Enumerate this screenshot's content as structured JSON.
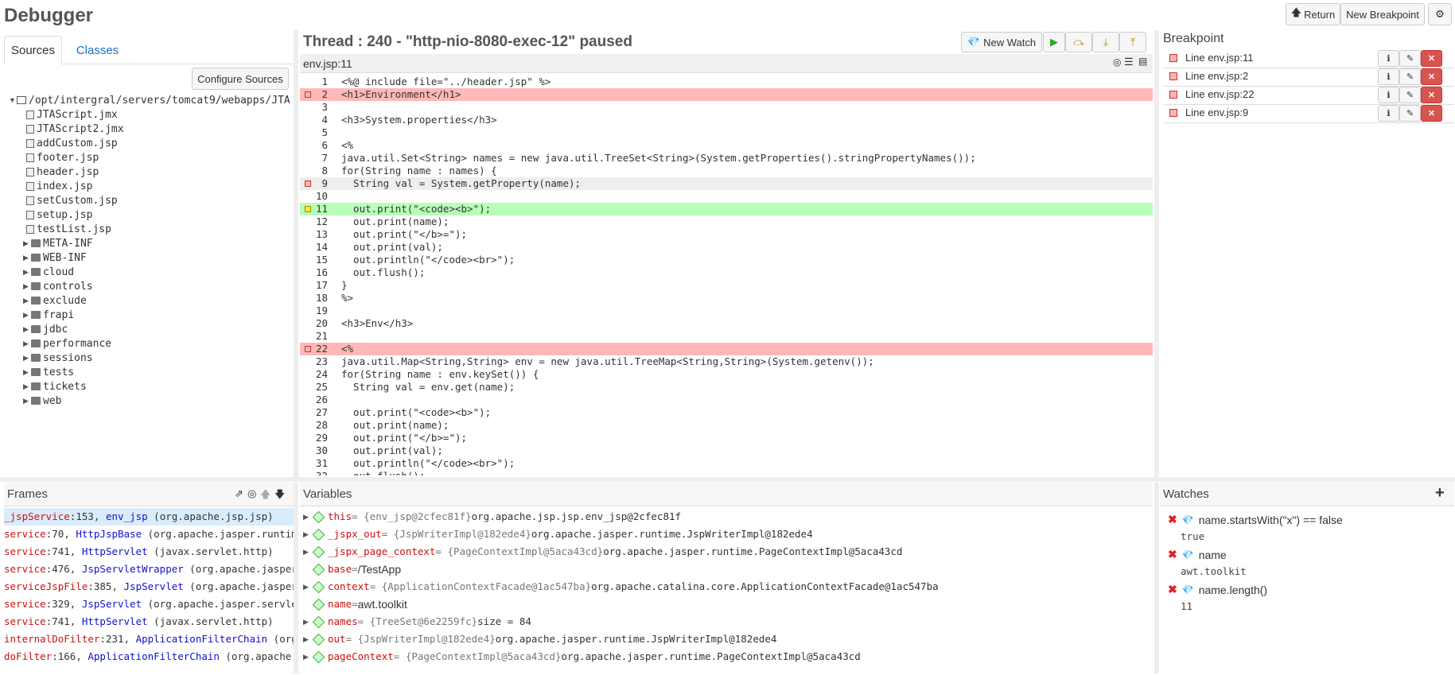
{
  "app": {
    "title": "Debugger",
    "return_label": "Return",
    "new_breakpoint_label": "New Breakpoint",
    "settings_icon": "gear-icon"
  },
  "sources": {
    "tabs": [
      "Sources",
      "Classes"
    ],
    "configure_label": "Configure Sources",
    "root": "/opt/intergral/servers/tomcat9/webapps/JTA",
    "files": [
      "JTAScript.jmx",
      "JTAScript2.jmx",
      "addCustom.jsp",
      "footer.jsp",
      "header.jsp",
      "index.jsp",
      "setCustom.jsp",
      "setup.jsp",
      "testList.jsp"
    ],
    "folders": [
      "META-INF",
      "WEB-INF",
      "cloud",
      "controls",
      "exclude",
      "frapi",
      "jdbc",
      "performance",
      "sessions",
      "tests",
      "tickets",
      "web"
    ]
  },
  "editor": {
    "thread_title": "Thread : 240 - \"http-nio-8080-exec-12\" paused",
    "new_watch_label": "New Watch",
    "filename": "env.jsp:11",
    "lines": [
      "<%@ include file=\"../header.jsp\" %>",
      "<h1>Environment</h1>",
      "",
      "<h3>System.properties</h3>",
      "",
      "<%",
      "java.util.Set<String> names = new java.util.TreeSet<String>(System.getProperties().stringPropertyNames());",
      "for(String name : names) {",
      "  String val = System.getProperty(name);",
      "",
      "  out.print(\"<code><b>\");",
      "  out.print(name);",
      "  out.print(\"</b>=\");",
      "  out.print(val);",
      "  out.println(\"</code><br>\");",
      "  out.flush();",
      "}",
      "%>",
      "",
      "<h3>Env</h3>",
      "",
      "<%",
      "java.util.Map<String,String> env = new java.util.TreeMap<String,String>(System.getenv());",
      "for(String name : env.keySet()) {",
      "  String val = env.get(name);",
      "",
      "  out.print(\"<code><b>\");",
      "  out.print(name);",
      "  out.print(\"</b>=\");",
      "  out.print(val);",
      "  out.println(\"</code><br>\");",
      "  out.flush();"
    ]
  },
  "breakpoints": {
    "title": "Breakpoint",
    "items": [
      "Line env.jsp:11",
      "Line env.jsp:2",
      "Line env.jsp:22",
      "Line env.jsp:9"
    ]
  },
  "frames": {
    "title": "Frames",
    "items": [
      {
        "method": "_jspService",
        "line": ":153, ",
        "cls": "env_jsp",
        "pkg": " (org.apache.jsp.jsp)"
      },
      {
        "method": "service",
        "line": ":70, ",
        "cls": "HttpJspBase",
        "pkg": " (org.apache.jasper.runtime"
      },
      {
        "method": "service",
        "line": ":741, ",
        "cls": "HttpServlet",
        "pkg": " (javax.servlet.http)"
      },
      {
        "method": "service",
        "line": ":476, ",
        "cls": "JspServletWrapper",
        "pkg": " (org.apache.jasper.s"
      },
      {
        "method": "serviceJspFile",
        "line": ":385, ",
        "cls": "JspServlet",
        "pkg": " (org.apache.jasper.s"
      },
      {
        "method": "service",
        "line": ":329, ",
        "cls": "JspServlet",
        "pkg": " (org.apache.jasper.servlet"
      },
      {
        "method": "service",
        "line": ":741, ",
        "cls": "HttpServlet",
        "pkg": " (javax.servlet.http)"
      },
      {
        "method": "internalDoFilter",
        "line": ":231, ",
        "cls": "ApplicationFilterChain",
        "pkg": " (org.a"
      },
      {
        "method": "doFilter",
        "line": ":166, ",
        "cls": "ApplicationFilterChain",
        "pkg": " (org.apache.ca"
      }
    ]
  },
  "variables": {
    "title": "Variables",
    "items": [
      {
        "name": "this",
        "type": " = {env_jsp@2cfec81f} ",
        "value": "org.apache.jsp.jsp.env_jsp@2cfec81f"
      },
      {
        "name": "_jspx_out",
        "type": " = {JspWriterImpl@182ede4} ",
        "value": "org.apache.jasper.runtime.JspWriterImpl@182ede4"
      },
      {
        "name": "_jspx_page_context",
        "type": " = {PageContextImpl@5aca43cd} ",
        "value": "org.apache.jasper.runtime.PageContextImpl@5aca43cd"
      },
      {
        "name": "base",
        "type": " = ",
        "value": "/TestApp"
      },
      {
        "name": "context",
        "type": " = {ApplicationContextFacade@1ac547ba} ",
        "value": "org.apache.catalina.core.ApplicationContextFacade@1ac547ba"
      },
      {
        "name": "name",
        "type": " = ",
        "value": "awt.toolkit"
      },
      {
        "name": "names",
        "type": " = {TreeSet@6e2259fc} ",
        "value": "size = 84"
      },
      {
        "name": "out",
        "type": " = {JspWriterImpl@182ede4} ",
        "value": "org.apache.jasper.runtime.JspWriterImpl@182ede4"
      },
      {
        "name": "pageContext",
        "type": " = {PageContextImpl@5aca43cd} ",
        "value": "org.apache.jasper.runtime.PageContextImpl@5aca43cd"
      }
    ]
  },
  "watches": {
    "title": "Watches",
    "items": [
      {
        "expr": "name.startsWith(\"x\") == false",
        "value": "true"
      },
      {
        "expr": "name",
        "value": "awt.toolkit"
      },
      {
        "expr": "name.length()",
        "value": "11"
      }
    ]
  }
}
